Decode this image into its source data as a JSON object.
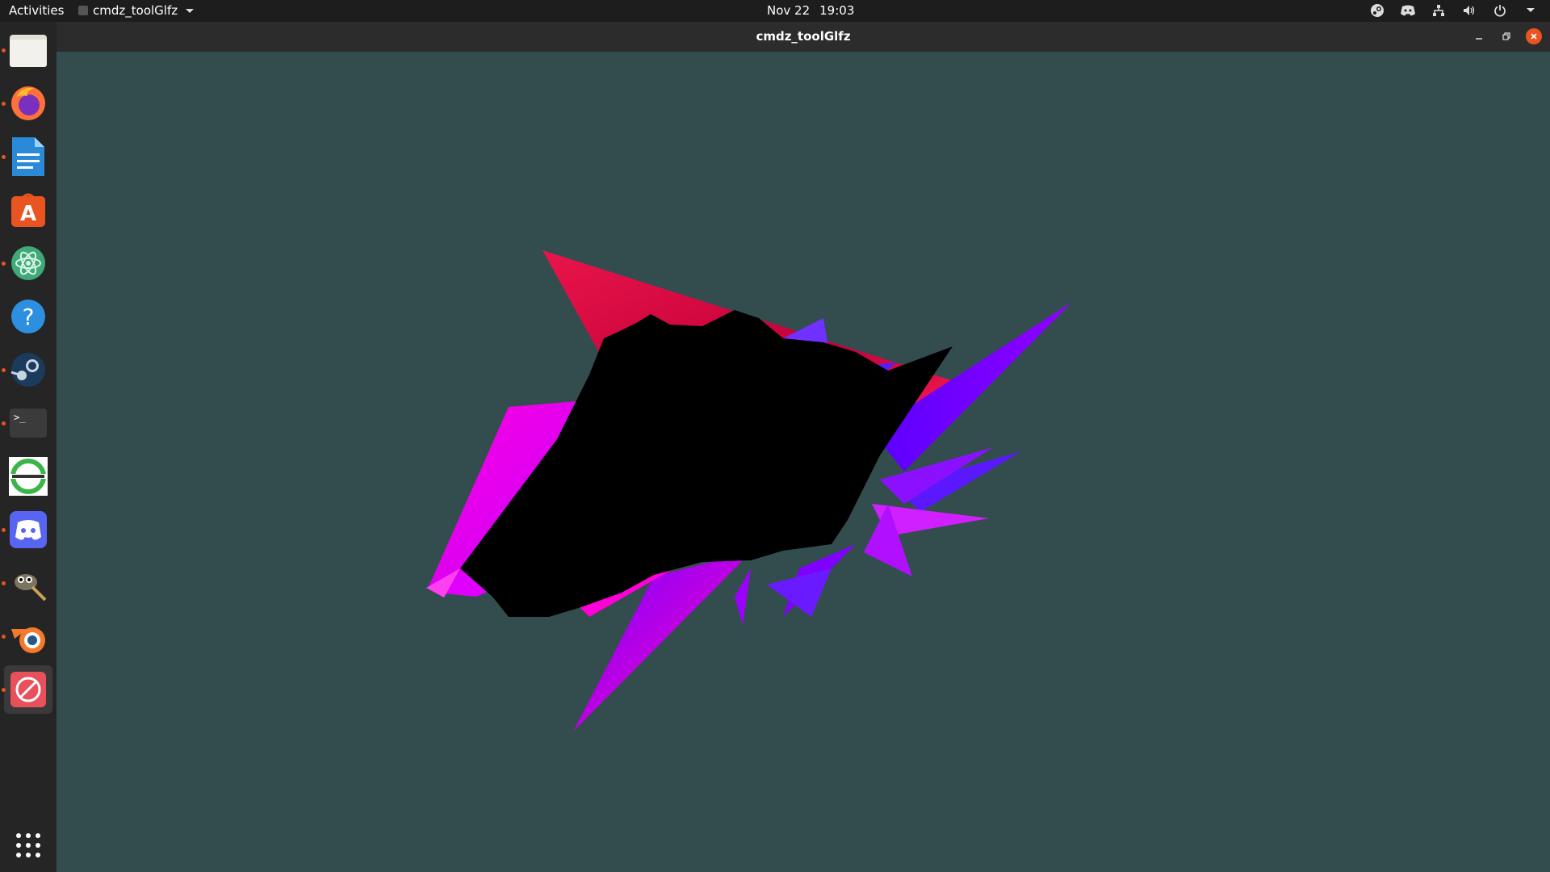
{
  "topbar": {
    "activities": "Activities",
    "app_name": "cmdz_toolGlfz",
    "date": "Nov 22",
    "time": "19:03",
    "tray_icons": [
      "steam-icon",
      "discord-icon",
      "network-icon",
      "volume-icon",
      "power-icon"
    ]
  },
  "dock": {
    "items": [
      {
        "name": "files",
        "icon": "folder-icon",
        "running": true
      },
      {
        "name": "firefox",
        "icon": "firefox-icon",
        "running": true
      },
      {
        "name": "libreoffice-writer",
        "icon": "document-icon",
        "running": true
      },
      {
        "name": "ubuntu-software",
        "icon": "store-icon",
        "running": false
      },
      {
        "name": "atom",
        "icon": "atom-icon",
        "running": true
      },
      {
        "name": "help",
        "icon": "help-icon",
        "running": false
      },
      {
        "name": "steam",
        "icon": "steam-icon",
        "running": true
      },
      {
        "name": "terminal",
        "icon": "terminal-icon",
        "running": true
      },
      {
        "name": "app-circle",
        "icon": "ring-icon",
        "running": false
      },
      {
        "name": "discord",
        "icon": "discord-icon",
        "running": true
      },
      {
        "name": "gimp",
        "icon": "gimp-icon",
        "running": true
      },
      {
        "name": "blender",
        "icon": "blender-icon",
        "running": true
      },
      {
        "name": "cmdz-tool",
        "icon": "no-entry-icon",
        "running": true
      }
    ],
    "show_apps": "grid-icon"
  },
  "window": {
    "title": "cmdz_toolGlfz",
    "background": "#334d4f",
    "controls": [
      "minimize-icon",
      "restore-icon",
      "close-icon"
    ]
  }
}
